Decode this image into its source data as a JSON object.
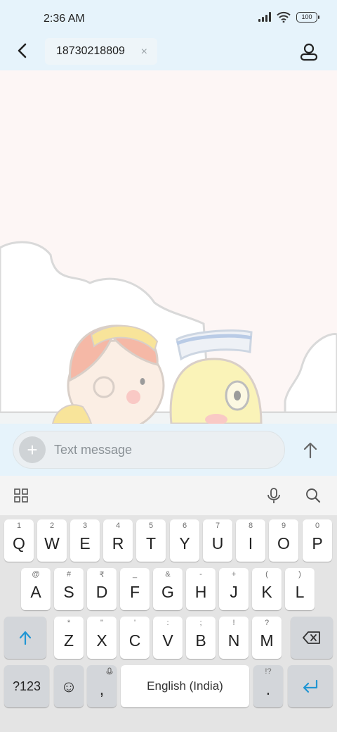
{
  "status": {
    "time": "2:36 AM",
    "battery": "100"
  },
  "header": {
    "recipient": "18730218809",
    "clear_icon": "×"
  },
  "compose": {
    "placeholder": "Text message",
    "add_icon": "+"
  },
  "keyboard": {
    "row1": [
      {
        "hint": "1",
        "key": "Q"
      },
      {
        "hint": "2",
        "key": "W"
      },
      {
        "hint": "3",
        "key": "E"
      },
      {
        "hint": "4",
        "key": "R"
      },
      {
        "hint": "5",
        "key": "T"
      },
      {
        "hint": "6",
        "key": "Y"
      },
      {
        "hint": "7",
        "key": "U"
      },
      {
        "hint": "8",
        "key": "I"
      },
      {
        "hint": "9",
        "key": "O"
      },
      {
        "hint": "0",
        "key": "P"
      }
    ],
    "row2": [
      {
        "hint": "@",
        "key": "A"
      },
      {
        "hint": "#",
        "key": "S"
      },
      {
        "hint": "₹",
        "key": "D"
      },
      {
        "hint": "_",
        "key": "F"
      },
      {
        "hint": "&",
        "key": "G"
      },
      {
        "hint": "-",
        "key": "H"
      },
      {
        "hint": "+",
        "key": "J"
      },
      {
        "hint": "(",
        "key": "K"
      },
      {
        "hint": ")",
        "key": "L"
      }
    ],
    "row3": [
      {
        "hint": "*",
        "key": "Z"
      },
      {
        "hint": "\"",
        "key": "X"
      },
      {
        "hint": "'",
        "key": "C"
      },
      {
        "hint": ":",
        "key": "V"
      },
      {
        "hint": ";",
        "key": "B"
      },
      {
        "hint": "!",
        "key": "N"
      },
      {
        "hint": "?",
        "key": "M"
      }
    ],
    "symbols_label": "?123",
    "emoji": "☺",
    "comma": ",",
    "space_label": "English (India)",
    "period": ".",
    "period_hint": "!?"
  },
  "colors": {
    "accent": "#2196d3",
    "header_bg": "#e6f3fb",
    "keyboard_bg": "#e4e4e4"
  }
}
